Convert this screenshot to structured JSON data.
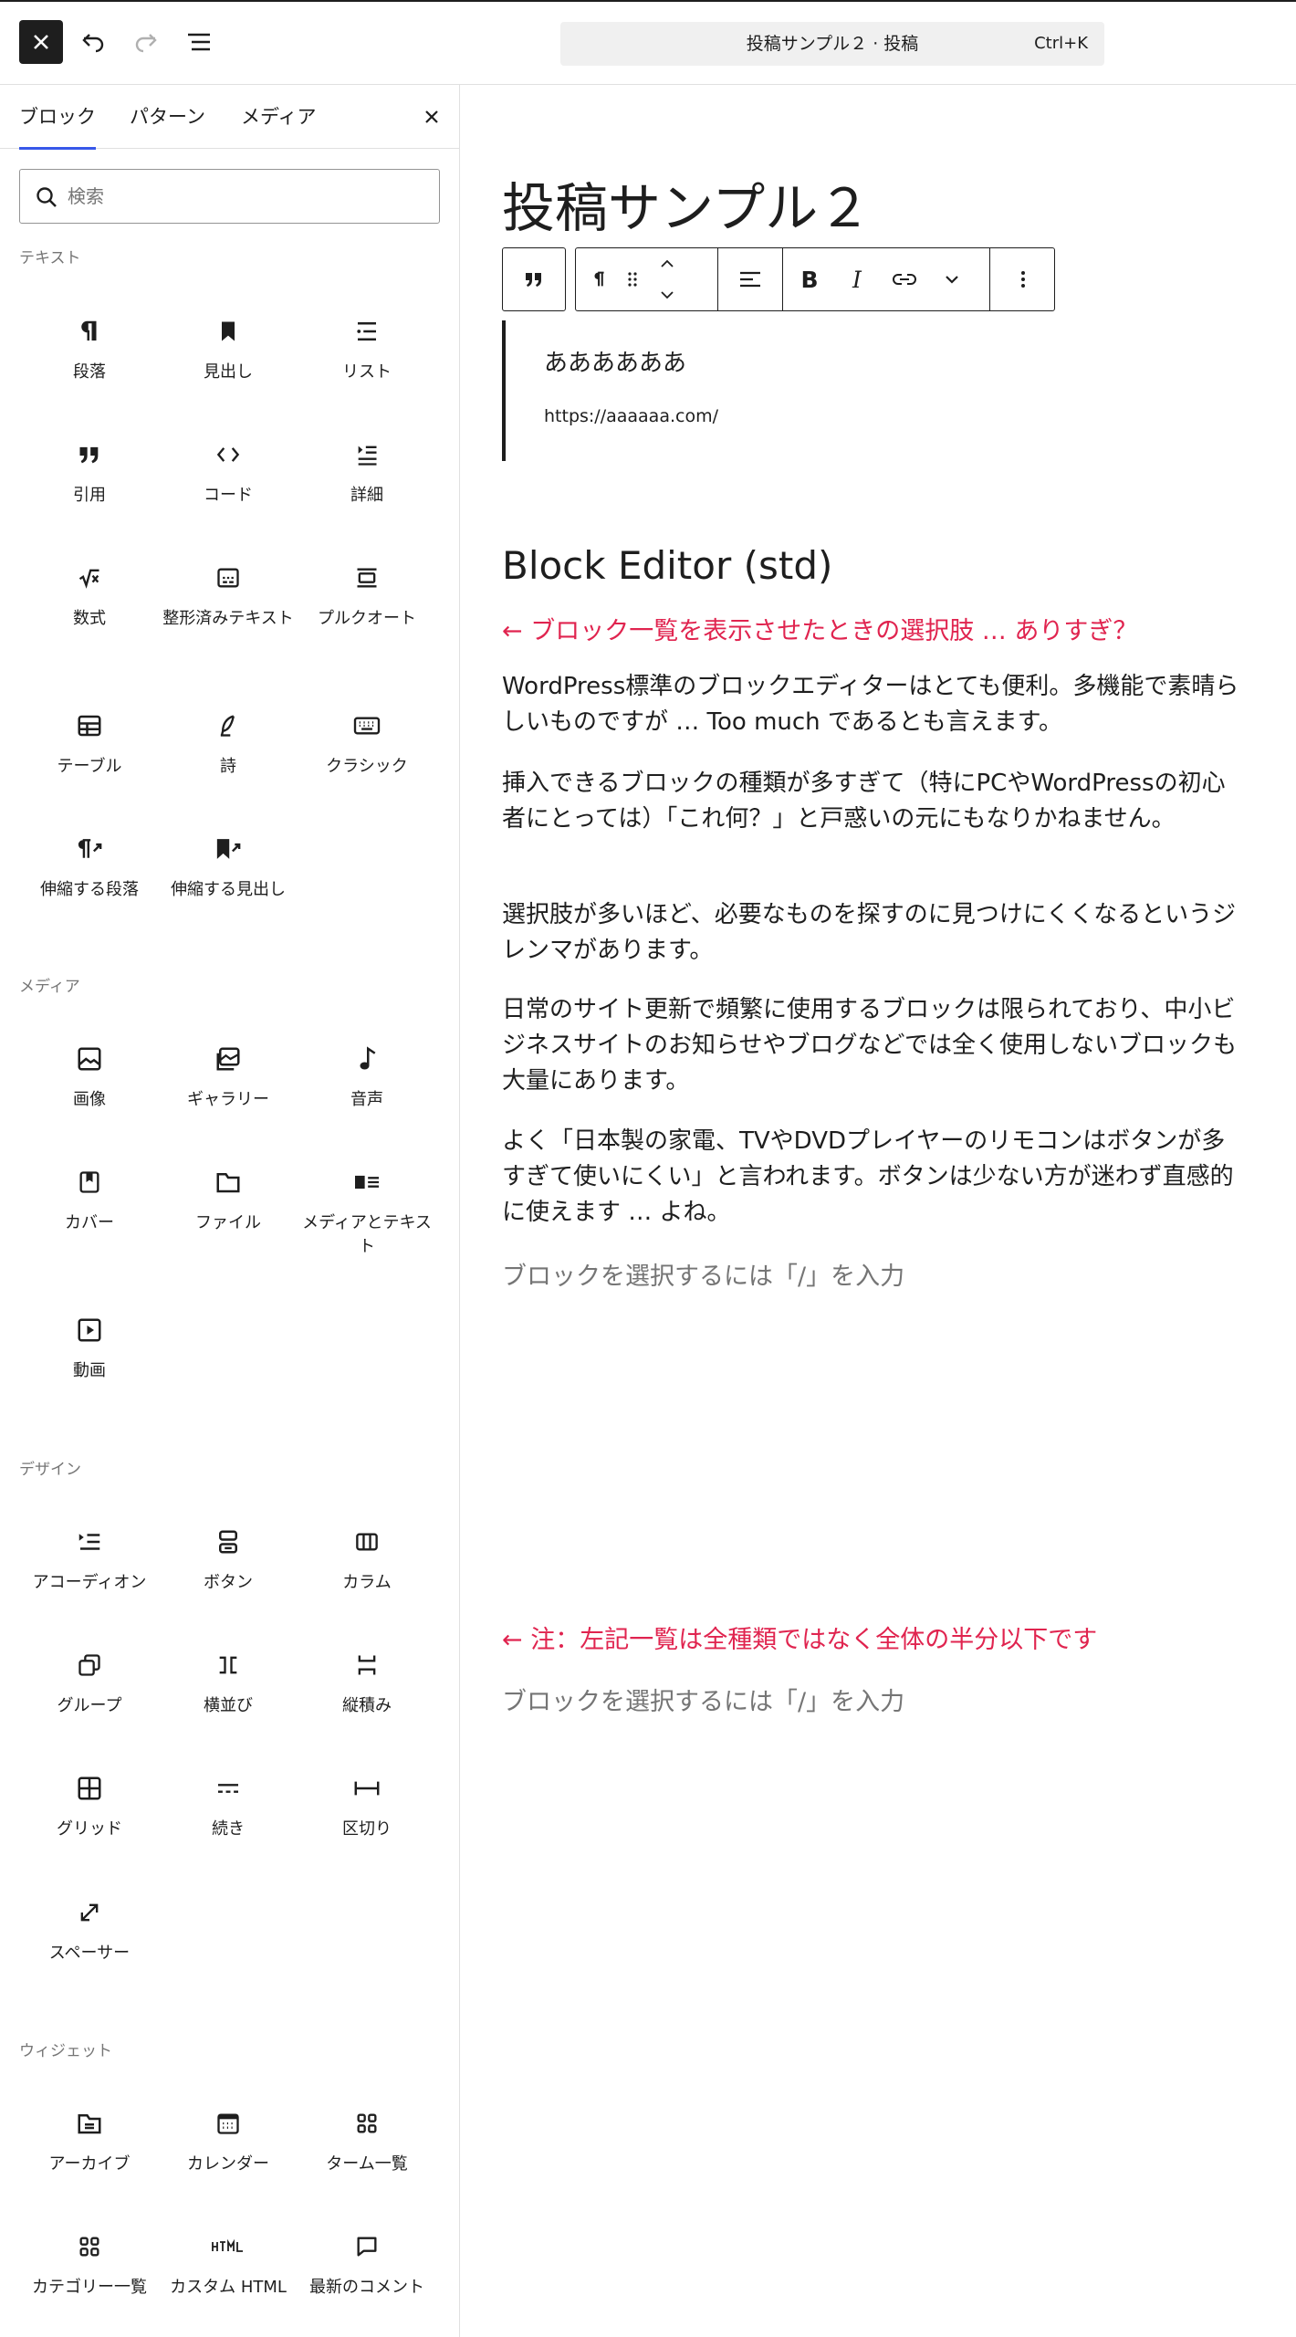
{
  "topbar": {
    "command_title": "投稿サンプル２ · 投稿",
    "command_shortcut": "Ctrl+K"
  },
  "sidebar": {
    "tabs": [
      "ブロック",
      "パターン",
      "メディア"
    ],
    "search_placeholder": "検索",
    "categories": {
      "text": {
        "label": "テキスト",
        "items": [
          "段落",
          "見出し",
          "リスト",
          "引用",
          "コード",
          "詳細",
          "数式",
          "整形済みテキスト",
          "プルクオート",
          "テーブル",
          "詩",
          "クラシック",
          "伸縮する段落",
          "伸縮する見出し"
        ]
      },
      "media": {
        "label": "メディア",
        "items": [
          "画像",
          "ギャラリー",
          "音声",
          "カバー",
          "ファイル",
          "メディアとテキスト",
          "動画"
        ]
      },
      "design": {
        "label": "デザイン",
        "items": [
          "アコーディオン",
          "ボタン",
          "カラム",
          "グループ",
          "横並び",
          "縦積み",
          "グリッド",
          "続き",
          "区切り",
          "スペーサー"
        ]
      },
      "widgets": {
        "label": "ウィジェット",
        "items": [
          "アーカイブ",
          "カレンダー",
          "ターム一覧",
          "カテゴリー一覧",
          "カスタム HTML",
          "最新のコメント"
        ]
      }
    }
  },
  "editor": {
    "post_title": "投稿サンプル２",
    "quote_text": "ああああああ",
    "quote_citation": "https://aaaaaa.com/",
    "heading": "Block Editor (std)",
    "note1": "← ブロック一覧を表示させたときの選択肢 … ありすぎ？",
    "paragraphs": [
      "WordPress標準のブロックエディターはとても便利。多機能で素晴らしいものですが … Too much であるとも言えます。",
      "挿入できるブロックの種類が多すぎて（特にPCやWordPressの初心者にとっては）「これ何？」と戸惑いの元にもなりかねません。",
      "選択肢が多いほど、必要なものを探すのに見つけにくくなるというジレンマがあります。",
      "日常のサイト更新で頻繁に使用するブロックは限られており、中小ビジネスサイトのお知らせやブログなどでは全く使用しないブロックも大量にあります。",
      "よく「日本製の家電、TVやDVDプレイヤーのリモコンはボタンが多すぎて使いにくい」と言われます。ボタンは少ない方が迷わず直感的に使えます … よね。"
    ],
    "placeholder1": "ブロックを選択するには「/」を入力",
    "note2": "← 注：左記一覧は全種類ではなく全体の半分以下です",
    "placeholder2": "ブロックを選択するには「/」を入力"
  },
  "colors": {
    "accent": "#3858e9",
    "annotation": "#e0244f",
    "muted": "#757575",
    "text": "#1e1e1e"
  }
}
